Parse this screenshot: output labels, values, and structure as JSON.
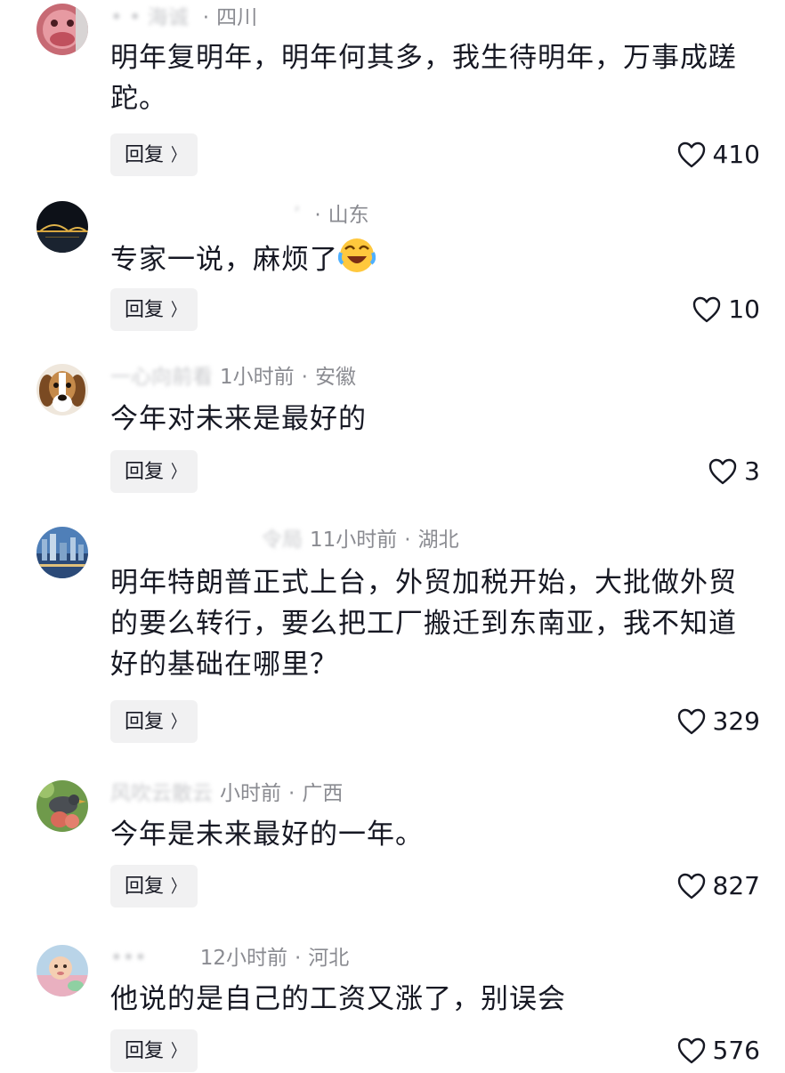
{
  "comments": [
    {
      "author": "• • 海诚",
      "time": "",
      "location": "四川",
      "text": "明年复明年，明年何其多，我生待明年，万事成蹉跎。",
      "reply_label": "回复",
      "likes": "410",
      "avatar": "pink-mascot-avatar"
    },
    {
      "author": "’",
      "time": "",
      "location": "山东",
      "text": "专家一说，麻烦了",
      "emoji": "laughing-crying-emoji",
      "reply_label": "回复",
      "likes": "10",
      "avatar": "night-bridge-avatar"
    },
    {
      "author": "一心向前看",
      "time": "1小时前",
      "location": "安徽",
      "text": "今年对未来是最好的",
      "reply_label": "回复",
      "likes": "3",
      "avatar": "beagle-dog-avatar"
    },
    {
      "author": "令局",
      "time": "11小时前",
      "location": "湖北",
      "text": "明年特朗普正式上台，外贸加税开始，大批做外贸的要么转行，要么把工厂搬迁到东南亚，我不知道好的基础在哪里？",
      "reply_label": "回复",
      "likes": "329",
      "avatar": "city-skyline-avatar"
    },
    {
      "author": "风吹云散云",
      "time": "小时前",
      "location": "广西",
      "text": "今年是未来最好的一年。",
      "reply_label": "回复",
      "likes": "827",
      "avatar": "bird-avatar"
    },
    {
      "author": "•••",
      "time": "12小时前",
      "location": "河北",
      "text": "他说的是自己的工资又涨了，别误会",
      "reply_label": "回复",
      "likes": "576",
      "avatar": "baby-avatar"
    }
  ],
  "icons": {
    "like": "heart-outline-icon",
    "reply_chevron": "chevron-right-icon"
  },
  "colors": {
    "text": "#161823",
    "meta": "#8a8b91",
    "reply_bg": "#f1f1f2"
  }
}
